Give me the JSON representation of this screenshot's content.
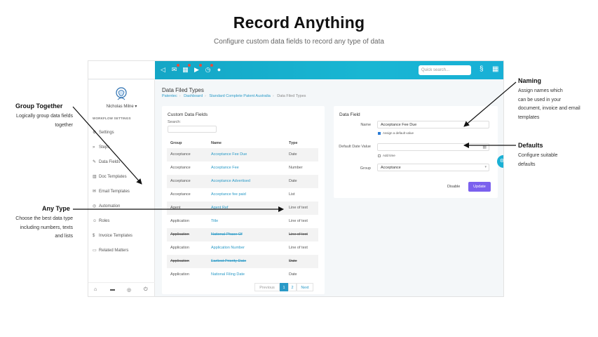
{
  "hero": {
    "title": "Record Anything",
    "subtitle": "Configure custom data fields to record any type of data"
  },
  "topbar": {
    "search_placeholder": "Quick search...",
    "icons": [
      "back-icon",
      "mail-icon",
      "calendar-icon",
      "play-icon",
      "clock-icon",
      "user-icon"
    ],
    "accent": "#18b0d6"
  },
  "sidebar": {
    "user_name": "Nicholas Milne ▾",
    "section_label": "WORKFLOW SETTINGS",
    "items": [
      {
        "label": "Settings",
        "icon": "gear-icon"
      },
      {
        "label": "Steps",
        "icon": "steps-icon"
      },
      {
        "label": "Data Fields",
        "icon": "edit-icon"
      },
      {
        "label": "Doc Templates",
        "icon": "book-icon"
      },
      {
        "label": "Email Templates",
        "icon": "mail-icon"
      },
      {
        "label": "Automation",
        "icon": "automation-icon"
      },
      {
        "label": "Roles",
        "icon": "users-icon"
      },
      {
        "label": "Invoice Templates",
        "icon": "dollar-icon"
      },
      {
        "label": "Related Matters",
        "icon": "folder-icon"
      }
    ]
  },
  "page": {
    "title": "Data Filed Types",
    "breadcrumb": [
      "Patentec",
      "Dashboard",
      "Standard Complete Patent Australia",
      "Data Filed Types"
    ]
  },
  "fields_table": {
    "title": "Custom Data Fields",
    "search_label": "Search:",
    "headers": [
      "Group",
      "Name",
      "Type"
    ],
    "rows": [
      {
        "group": "Acceptance",
        "name": "Acceptance Fee Due",
        "type": "Date",
        "strike": false
      },
      {
        "group": "Acceptance",
        "name": "Acceptance Fee",
        "type": "Number",
        "strike": false
      },
      {
        "group": "Acceptance",
        "name": "Acceptance Advertised",
        "type": "Date",
        "strike": false
      },
      {
        "group": "Acceptance",
        "name": "Acceptance fee paid",
        "type": "List",
        "strike": false
      },
      {
        "group": "Agent",
        "name": "Agent Ref",
        "type": "Line of text",
        "strike": false
      },
      {
        "group": "Application",
        "name": "Title",
        "type": "Line of text",
        "strike": false
      },
      {
        "group": "Application",
        "name": "National Phase Of",
        "type": "Line of text",
        "strike": true
      },
      {
        "group": "Application",
        "name": "Application Number",
        "type": "Line of text",
        "strike": false
      },
      {
        "group": "Application",
        "name": "Earliest Priority Date",
        "type": "Date",
        "strike": true
      },
      {
        "group": "Application",
        "name": "National Filing Date",
        "type": "Date",
        "strike": false
      }
    ],
    "pagination": {
      "prev": "Previous",
      "pages": [
        "1",
        "2"
      ],
      "next": "Next"
    }
  },
  "data_field": {
    "title": "Data Field",
    "name_label": "Name",
    "name_value": "Acceptance Fee Due",
    "assign_default_label": "Assign a default value",
    "default_label": "Default Date Value",
    "add_time_label": "Add time",
    "group_label": "Group",
    "group_value": "Acceptance",
    "disable_label": "Disable",
    "update_label": "Update",
    "update_color": "#7b61ee"
  },
  "annotations": {
    "group": {
      "title": "Group Together",
      "lines": [
        "Logically group data fields",
        "together"
      ]
    },
    "type": {
      "title": "Any Type",
      "lines": [
        "Choose the best data type",
        "including numbers, texts",
        "and lists"
      ]
    },
    "naming": {
      "title": "Naming",
      "lines": [
        "Assign names which",
        "can be used in your",
        "document, invoice and email",
        "templates"
      ]
    },
    "defaults": {
      "title": "Defaults",
      "lines": [
        "Configure suitable",
        "defaults"
      ]
    }
  }
}
